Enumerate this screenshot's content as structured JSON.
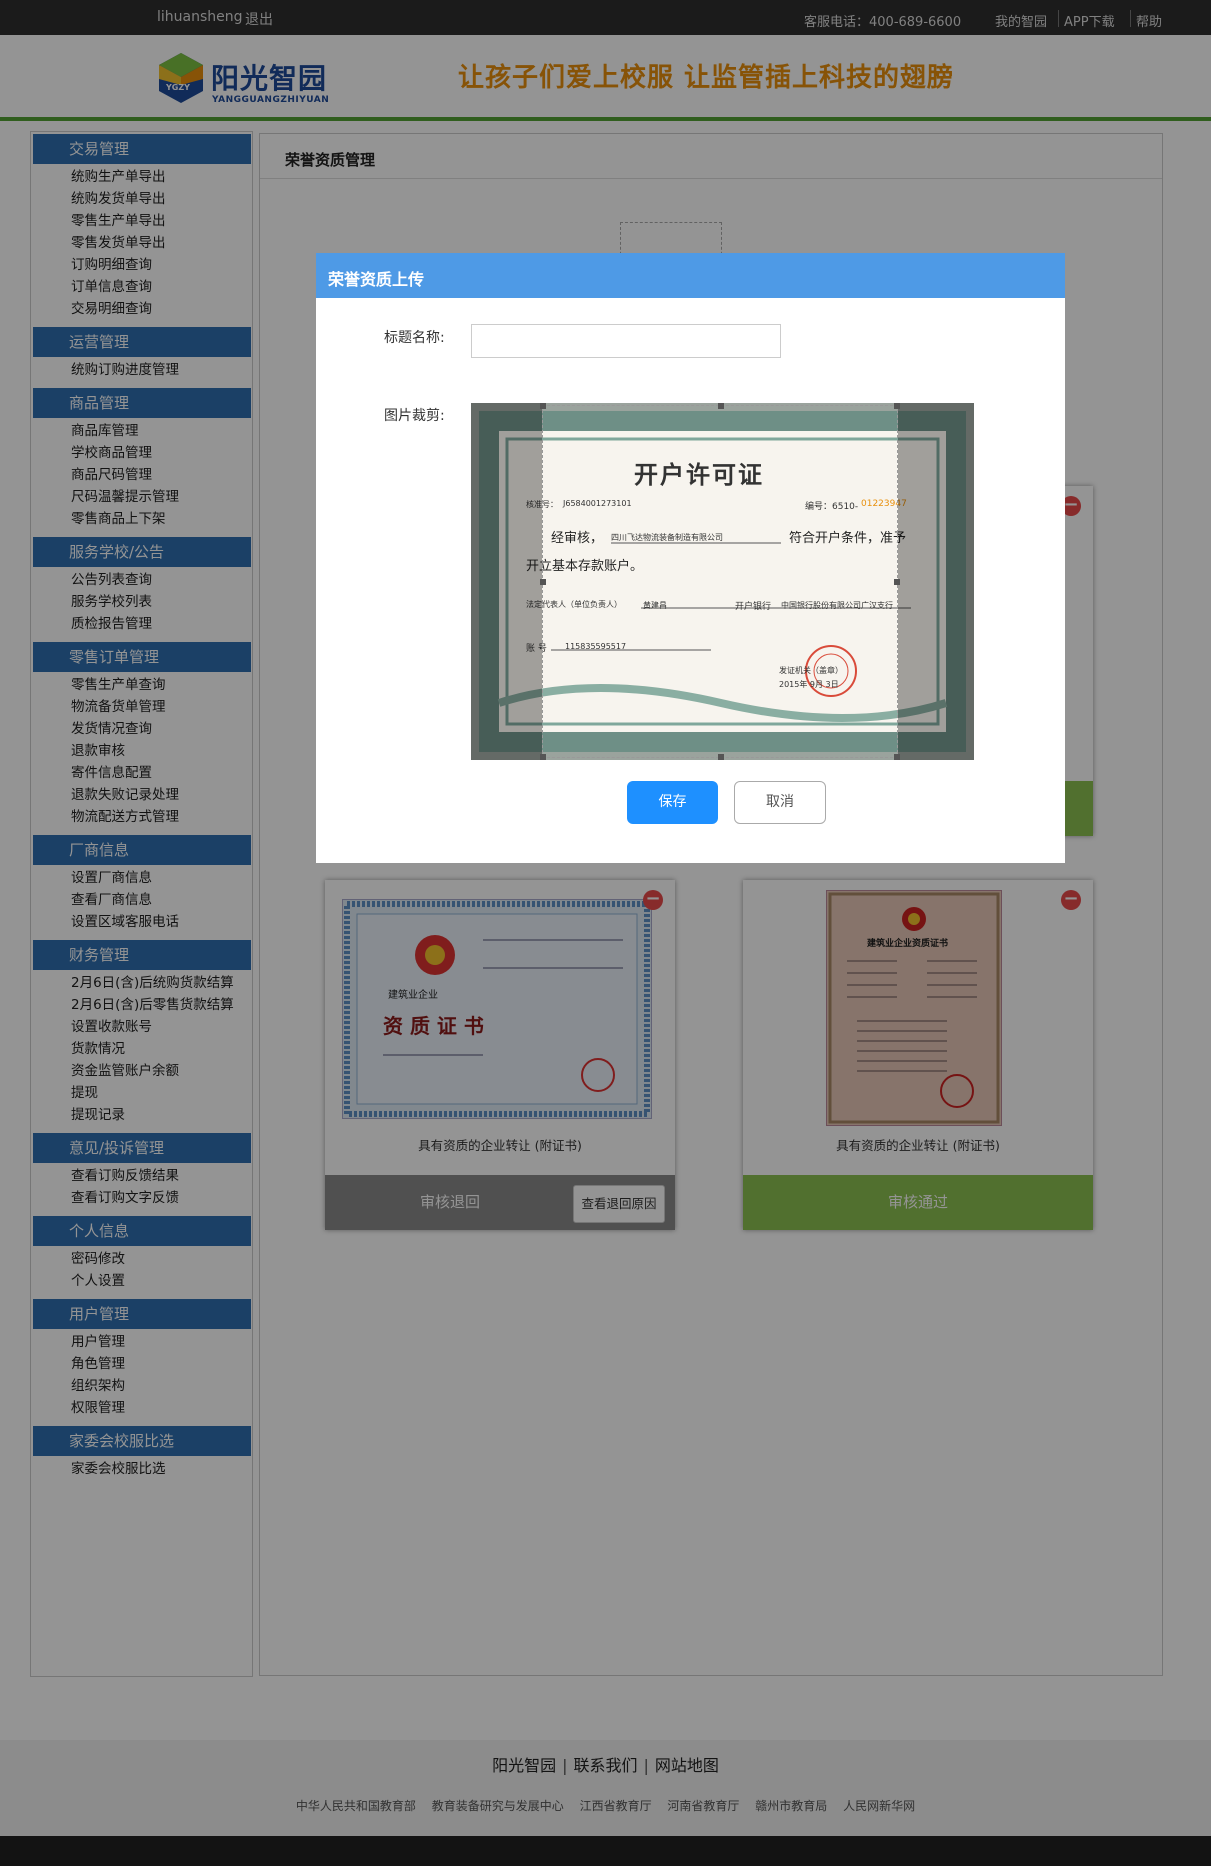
{
  "topbar": {
    "username": "lihuansheng",
    "logout": "退出",
    "phone": "客服电话：400-689-6600",
    "links": [
      "我的智园",
      "APP下载",
      "帮助"
    ]
  },
  "header": {
    "logo_cn": "阳光智园",
    "logo_en": "YANGGUANGZHIYUAN",
    "logo_badge": "YGZY",
    "slogan": "让孩子们爱上校服  让监管插上科技的翅膀"
  },
  "sidebar": [
    {
      "title": "交易管理",
      "items": [
        "统购生产单导出",
        "统购发货单导出",
        "零售生产单导出",
        "零售发货单导出",
        "订购明细查询",
        "订单信息查询",
        "交易明细查询"
      ]
    },
    {
      "title": "运营管理",
      "items": [
        "统购订购进度管理"
      ]
    },
    {
      "title": "商品管理",
      "items": [
        "商品库管理",
        "学校商品管理",
        "商品尺码管理",
        "尺码温馨提示管理",
        "零售商品上下架"
      ]
    },
    {
      "title": "服务学校/公告",
      "items": [
        "公告列表查询",
        "服务学校列表",
        "质检报告管理"
      ]
    },
    {
      "title": "零售订单管理",
      "items": [
        "零售生产单查询",
        "物流备货单管理",
        "发货情况查询",
        "退款审核",
        "寄件信息配置",
        "退款失败记录处理",
        "物流配送方式管理"
      ]
    },
    {
      "title": "厂商信息",
      "items": [
        "设置厂商信息",
        "查看厂商信息",
        "设置区域客服电话"
      ]
    },
    {
      "title": "财务管理",
      "items": [
        "2月6日(含)后统购货款结算",
        "2月6日(含)后零售货款结算",
        "设置收款账号",
        "货款情况",
        "资金监管账户余额",
        "提现",
        "提现记录"
      ]
    },
    {
      "title": "意见/投诉管理",
      "items": [
        "查看订购反馈结果",
        "查看订购文字反馈"
      ]
    },
    {
      "title": "个人信息",
      "items": [
        "密码修改",
        "个人设置"
      ]
    },
    {
      "title": "用户管理",
      "items": [
        "用户管理",
        "角色管理",
        "组织架构",
        "权限管理"
      ]
    },
    {
      "title": "家委会校服比选",
      "items": [
        "家委会校服比选"
      ]
    }
  ],
  "main": {
    "title": "荣誉资质管理",
    "cards": [
      {
        "caption": "具有资质的企业转让 (附证书)",
        "status": "审核退回",
        "reason_button": "查看退回原因",
        "status_color": "#8a8a8a",
        "cert_title": "资 质 证 书",
        "cert_subtitle": "建筑业企业"
      },
      {
        "caption": "具有资质的企业转让 (附证书)",
        "status": "审核通过",
        "status_color": "#8cc152",
        "cert_title": "建筑业企业资质证书"
      }
    ],
    "hidden_card_status_color": "#8cc152"
  },
  "modal": {
    "title": "荣誉资质上传",
    "title_label": "标题名称:",
    "title_value": "",
    "crop_label": "图片裁剪:",
    "save": "保存",
    "cancel": "取消",
    "cert": {
      "heading": "开户许可证",
      "number_label": "核准号：",
      "number": "J6584001273101",
      "serial_label": "编号：6510-",
      "serial": "01223947",
      "approved": "经审核，",
      "company": "四川飞达物流装备制造有限公司",
      "meets": "符合开户条件，准予",
      "open": "开立基本存款账户。",
      "legal_label": "法定代表人（单位负责人）",
      "legal_name": "黄建昌",
      "bank_label": "开户银行",
      "bank": "中国银行股份有限公司广汉支行",
      "account_label": "账  号",
      "account": "115835595517",
      "issuer": "发证机关（盖章）",
      "date": "2015年 9月 3日"
    }
  },
  "footer": {
    "links": [
      "阳光智园",
      "联系我们",
      "网站地图"
    ],
    "sub_links": [
      "中华人民共和国教育部",
      "教育装备研究与发展中心",
      "江西省教育厅",
      "河南省教育厅",
      "赣州市教育局",
      "人民网新华网"
    ]
  }
}
